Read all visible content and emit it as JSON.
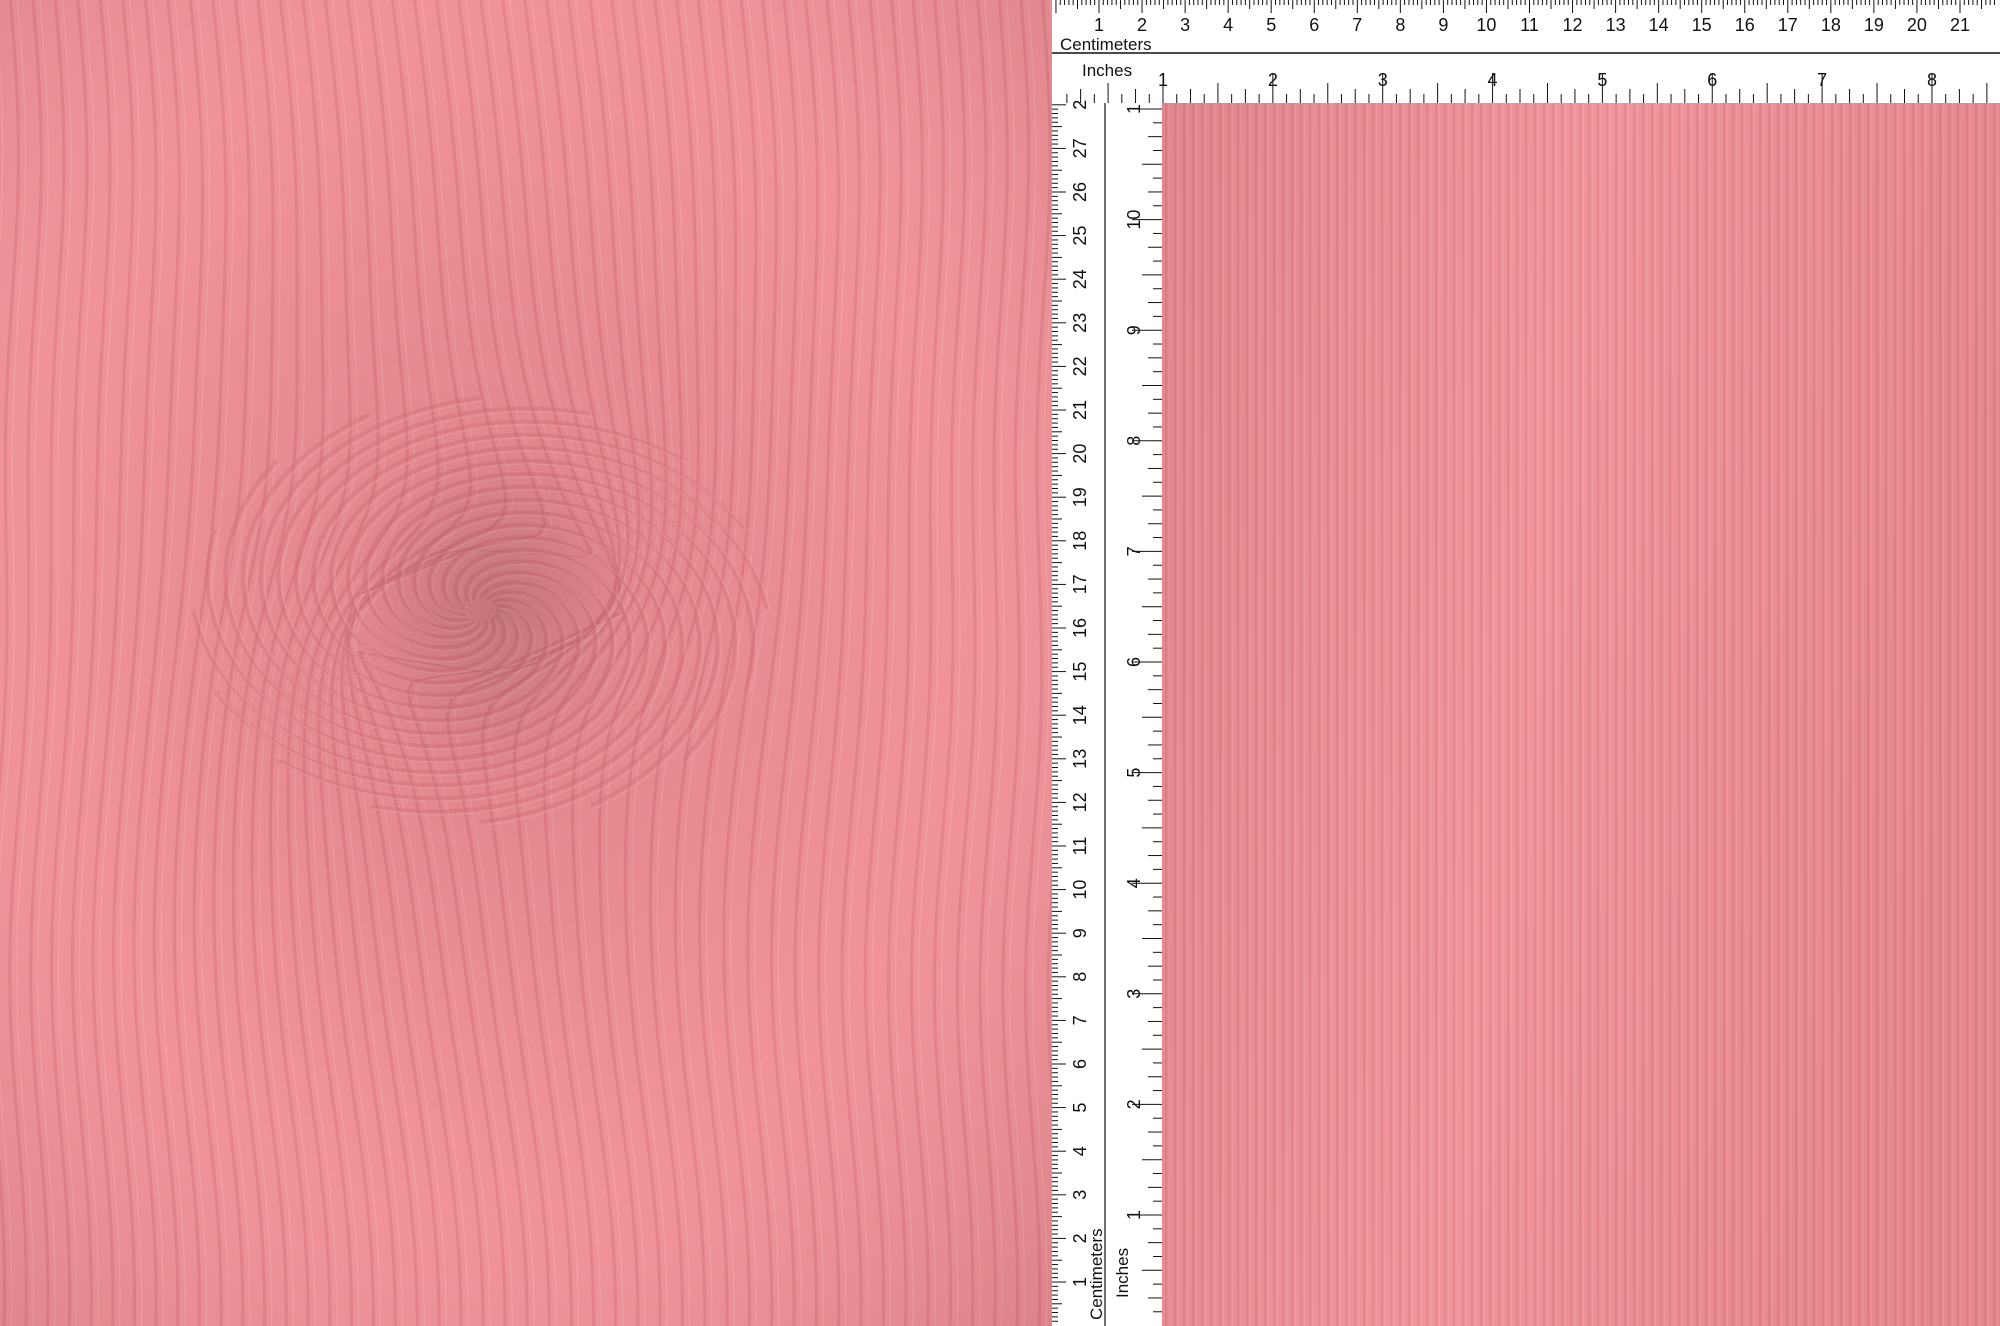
{
  "colors": {
    "fabric": "#ef8f95",
    "fabric_shadow": "#d9737b",
    "fabric_highlight": "#f7a9ad",
    "ruler": "#ffffff",
    "ruler_ink": "#111111"
  },
  "ruler_top": {
    "unit_cm": "Centimeters",
    "unit_in": "Inches",
    "cm_labels": [
      "1",
      "2",
      "3",
      "4",
      "5",
      "6",
      "7",
      "8",
      "9",
      "10",
      "11",
      "12",
      "13",
      "14",
      "15",
      "16",
      "17",
      "18",
      "19",
      "20",
      "21"
    ],
    "in_labels": [
      "1",
      "2",
      "3",
      "4",
      "5",
      "6",
      "7",
      "8"
    ]
  },
  "ruler_left": {
    "unit_cm": "Centimeters",
    "unit_in": "Inches",
    "cm_labels": [
      "1",
      "2",
      "3",
      "4",
      "5",
      "6",
      "7",
      "8",
      "9",
      "10",
      "11",
      "12",
      "13",
      "14",
      "15",
      "16",
      "17",
      "18",
      "19",
      "20",
      "21",
      "22",
      "23",
      "24",
      "25",
      "26",
      "27",
      "2"
    ],
    "in_labels": [
      "1",
      "2",
      "3",
      "4",
      "5",
      "6",
      "7",
      "8",
      "9",
      "10",
      "1"
    ]
  }
}
